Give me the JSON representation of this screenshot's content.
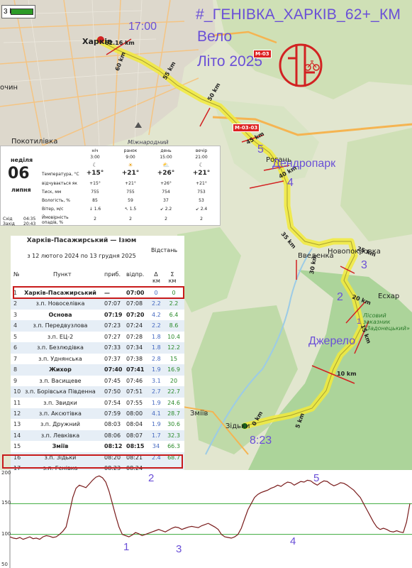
{
  "map": {
    "scale_label": "3 km",
    "title": "#_ГЕНІВКА_ХАРКІВ_62+_КМ",
    "subtitle_line1": "Вело",
    "subtitle_line2": "Літо 2025",
    "labels": {
      "kharkiv": "Харків",
      "pokotylivka": "Покотилівка",
      "mizhnarodnyi": "Міжнародний",
      "rohan": "Рогань",
      "novopokrovka": "Новопокровка",
      "vvedenka": "Введенка",
      "eskhar": "Есхар",
      "zmiiv": "Зміїв",
      "zidky": "Зідьки",
      "ochyn": "очин",
      "zapovidnyk": "Лісовий заказник «Задонецький»"
    },
    "roads": [
      "M-03",
      "M-03-03"
    ],
    "time_start": "17:00",
    "time_end": "8:23",
    "start_km": "62.16 km",
    "km_marks": [
      "60 km",
      "55 km",
      "50 km",
      "45 km",
      "40 km",
      "35 km",
      "30 km",
      "25 km",
      "20 km",
      "15 km",
      "10 km",
      "5 km",
      "0 km"
    ],
    "points": {
      "p1": "1",
      "p2": "2",
      "p3": "3",
      "p4": "4",
      "p5": "5",
      "dendropark": "Дендропарк",
      "dzherelo": "Джерело"
    }
  },
  "weather": {
    "day_name": "неділя",
    "day_num": "06",
    "month": "липня",
    "sunrise_label": "Схід",
    "sunrise": "04:35",
    "sunset_label": "Захід",
    "sunset": "20:43",
    "columns": [
      {
        "name": "ніч",
        "time": "3:00",
        "icon": "moon-icon",
        "temp": "+15°",
        "feels": "+15°",
        "pressure": "755",
        "humidity": "85",
        "wind": "1.6",
        "precip": "2"
      },
      {
        "name": "ранок",
        "time": "9:00",
        "icon": "sun-icon",
        "temp": "+21°",
        "feels": "+21°",
        "pressure": "755",
        "humidity": "59",
        "wind": "1.5",
        "precip": "2"
      },
      {
        "name": "день",
        "time": "15:00",
        "icon": "cloud-sun-icon",
        "temp": "+26°",
        "feels": "+26°",
        "pressure": "754",
        "humidity": "37",
        "wind": "2.2",
        "precip": "2"
      },
      {
        "name": "вечір",
        "time": "21:00",
        "icon": "moon-icon",
        "temp": "+21°",
        "feels": "+21°",
        "pressure": "753",
        "humidity": "53",
        "wind": "2.4",
        "precip": "2"
      }
    ],
    "row_labels": {
      "temp": "Температура, °C",
      "feels": "відчувається як",
      "pressure": "Тиск, мм",
      "humidity": "Вологість, %",
      "wind": "Вітер, м/с",
      "precip": "Ймовірність опадів, %"
    }
  },
  "timetable": {
    "route": "Харків-Пасажирський — Ізюм",
    "dates": "з 12 лютого 2024 по 13 грудня 2025",
    "distance_label": "Відстань",
    "col_no": "№",
    "col_stop": "Пункт",
    "col_arr": "приб.",
    "col_dep": "відпр.",
    "col_delta": "Δ км",
    "col_sum": "Σ км",
    "rows": [
      {
        "n": "1",
        "stop": "Харків-Пасажирський",
        "arr": "—",
        "dep": "07:00",
        "d": "0",
        "s": "0",
        "bold": true
      },
      {
        "n": "2",
        "stop": "з.п. Новоселівка",
        "arr": "07:07",
        "dep": "07:08",
        "d": "2.2",
        "s": "2.2",
        "bold": false
      },
      {
        "n": "3",
        "stop": "Основа",
        "arr": "07:19",
        "dep": "07:20",
        "d": "4.2",
        "s": "6.4",
        "bold": true
      },
      {
        "n": "4",
        "stop": "з.п. Передвузлова",
        "arr": "07:23",
        "dep": "07:24",
        "d": "2.2",
        "s": "8.6",
        "bold": false
      },
      {
        "n": "5",
        "stop": "з.п. ЕЦ-2",
        "arr": "07:27",
        "dep": "07:28",
        "d": "1.8",
        "s": "10.4",
        "bold": false
      },
      {
        "n": "6",
        "stop": "з.п. Безлюдівка",
        "arr": "07:33",
        "dep": "07:34",
        "d": "1.8",
        "s": "12.2",
        "bold": false
      },
      {
        "n": "7",
        "stop": "з.п. Уднянська",
        "arr": "07:37",
        "dep": "07:38",
        "d": "2.8",
        "s": "15",
        "bold": false
      },
      {
        "n": "8",
        "stop": "Жихор",
        "arr": "07:40",
        "dep": "07:41",
        "d": "1.9",
        "s": "16.9",
        "bold": true
      },
      {
        "n": "9",
        "stop": "з.п. Васищеве",
        "arr": "07:45",
        "dep": "07:46",
        "d": "3.1",
        "s": "20",
        "bold": false
      },
      {
        "n": "10",
        "stop": "з.п. Борівська Південна",
        "arr": "07:50",
        "dep": "07:51",
        "d": "2.7",
        "s": "22.7",
        "bold": false
      },
      {
        "n": "11",
        "stop": "з.п. Звидки",
        "arr": "07:54",
        "dep": "07:55",
        "d": "1.9",
        "s": "24.6",
        "bold": false
      },
      {
        "n": "12",
        "stop": "з.п. Аксютівка",
        "arr": "07:59",
        "dep": "08:00",
        "d": "4.1",
        "s": "28.7",
        "bold": false
      },
      {
        "n": "13",
        "stop": "з.п. Дружний",
        "arr": "08:03",
        "dep": "08:04",
        "d": "1.9",
        "s": "30.6",
        "bold": false
      },
      {
        "n": "14",
        "stop": "з.п. Левківка",
        "arr": "08:06",
        "dep": "08:07",
        "d": "1.7",
        "s": "32.3",
        "bold": false
      },
      {
        "n": "15",
        "stop": "Зміїв",
        "arr": "08:12",
        "dep": "08:15",
        "d": "34",
        "s": "66.3",
        "bold": true
      },
      {
        "n": "16",
        "stop": "з.п. Зідьки",
        "arr": "08:20",
        "dep": "08:21",
        "d": "2.4",
        "s": "68.7",
        "bold": false
      },
      {
        "n": "17",
        "stop": "з.п. Генівка",
        "arr": "08:23",
        "dep": "08:24",
        "d": "",
        "s": "",
        "bold": false
      }
    ]
  },
  "profile": {
    "y_ticks": [
      "200",
      "150",
      "100",
      "50"
    ],
    "marks": [
      "1",
      "2",
      "3",
      "4",
      "5"
    ],
    "elevation": [
      96,
      94,
      93,
      95,
      92,
      94,
      96,
      93,
      94,
      92,
      96,
      98,
      97,
      95,
      96,
      100,
      105,
      112,
      135,
      160,
      175,
      180,
      178,
      176,
      182,
      188,
      193,
      195,
      192,
      185,
      170,
      150,
      130,
      112,
      100,
      98,
      96,
      99,
      103,
      101,
      98,
      100,
      102,
      104,
      106,
      108,
      106,
      104,
      107,
      110,
      112,
      111,
      108,
      110,
      112,
      113,
      112,
      111,
      114,
      116,
      118,
      115,
      112,
      108,
      100,
      96,
      95,
      94,
      96,
      100,
      110,
      125,
      140,
      150,
      160,
      165,
      168,
      170,
      172,
      175,
      177,
      180,
      178,
      182,
      185,
      184,
      180,
      183,
      186,
      185,
      188,
      187,
      183,
      180,
      184,
      187,
      186,
      182,
      179,
      181,
      184,
      183,
      180,
      176,
      172,
      166,
      160,
      150,
      140,
      130,
      120,
      112,
      108,
      110,
      108,
      105,
      104,
      106,
      104,
      103,
      120,
      150
    ]
  },
  "colors": {
    "accent": "#6a4fd7",
    "route": "#f2ea3a",
    "marker": "#d22222",
    "profile_line": "#7a1c1c",
    "grid_green": "#3ca93c"
  }
}
